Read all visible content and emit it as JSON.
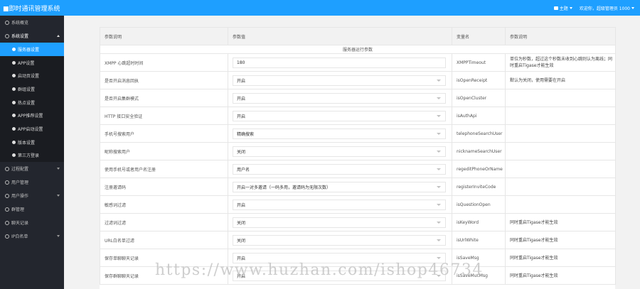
{
  "header": {
    "title": "■即时通讯管理系统",
    "theme_label": "主题",
    "welcome": "欢迎你，超级管理员 1000"
  },
  "sidebar": {
    "items": [
      {
        "label": "系统概览",
        "icon": "home-icon"
      },
      {
        "label": "系统设置",
        "icon": "settings-icon",
        "open": true
      }
    ],
    "sub_items": [
      {
        "label": "服务器设置",
        "active": true
      },
      {
        "label": "APP设置"
      },
      {
        "label": "启动页设置"
      },
      {
        "label": "群组设置"
      },
      {
        "label": "热点设置"
      },
      {
        "label": "APP推荐设置"
      },
      {
        "label": "APP启动设置"
      },
      {
        "label": "版本设置"
      },
      {
        "label": "第三方登录"
      }
    ],
    "lower_items": [
      {
        "label": "过程配置",
        "icon": "config-icon",
        "arrow": true
      },
      {
        "label": "用户管理",
        "icon": "user-icon"
      },
      {
        "label": "用户操作",
        "icon": "user-op-icon",
        "arrow": true
      },
      {
        "label": "群管理",
        "icon": "group-icon"
      },
      {
        "label": "聊天记录",
        "icon": "chat-icon"
      },
      {
        "label": "IP白名单",
        "icon": "ip-icon",
        "arrow": true
      }
    ]
  },
  "table": {
    "headers": [
      "参数说明",
      "参数值",
      "变量名",
      "参数说明"
    ],
    "section_label": "服务器运行参数",
    "rows": [
      {
        "label": "XMPP 心跳超时时间",
        "value": "180",
        "type": "input",
        "var": "XMPPTimeout",
        "desc": "单位为秒数，超过这个秒数未收到心跳则认为离线；同时重启Tigase才能生效"
      },
      {
        "label": "是否开启消息回执",
        "value": "开启",
        "type": "select",
        "var": "isOpenReceipt",
        "desc": "默认为关闭，使用需要在开启"
      },
      {
        "label": "是否开启集群模式",
        "value": "开启",
        "type": "select",
        "var": "isOpenCluster",
        "desc": ""
      },
      {
        "label": "HTTP 接口安全验证",
        "value": "开启",
        "type": "select",
        "var": "isAuthApi",
        "desc": ""
      },
      {
        "label": "手机号搜索用户",
        "value": "精确搜索",
        "type": "select",
        "var": "telephoneSearchUser",
        "desc": ""
      },
      {
        "label": "昵称搜索用户",
        "value": "关闭",
        "type": "select",
        "var": "nicknameSearchUser",
        "desc": ""
      },
      {
        "label": "使用手机号或者用户名注册",
        "value": "用户名",
        "type": "select",
        "var": "regeditPhoneOrName",
        "desc": ""
      },
      {
        "label": "注册邀请码",
        "value": "开启一对多邀请（一码多用，邀请码为无限次数）",
        "type": "select",
        "var": "registerInviteCode",
        "desc": ""
      },
      {
        "label": "敏感词过滤",
        "value": "开启",
        "type": "select",
        "var": "isQuestionOpen",
        "desc": ""
      },
      {
        "label": "过滤词过滤",
        "value": "关闭",
        "type": "select",
        "var": "isKeyWord",
        "desc": "同时重启Tigase才能生效"
      },
      {
        "label": "URL白名单过滤",
        "value": "关闭",
        "type": "select",
        "var": "isUrlWhite",
        "desc": "同时重启Tigase才能生效"
      },
      {
        "label": "保存单聊聊天记录",
        "value": "开启",
        "type": "select",
        "var": "isSaveMsg",
        "desc": "同时重启Tigase才能生效"
      },
      {
        "label": "保存群聊聊天记录",
        "value": "开启",
        "type": "select",
        "var": "isSaveMucMsg",
        "desc": "同时重启Tigase才能生效"
      }
    ]
  },
  "watermark": "https://www.huzhan.com/ishop46734",
  "colors": {
    "accent": "#1e9fff",
    "sidebar_bg": "#23262e"
  }
}
